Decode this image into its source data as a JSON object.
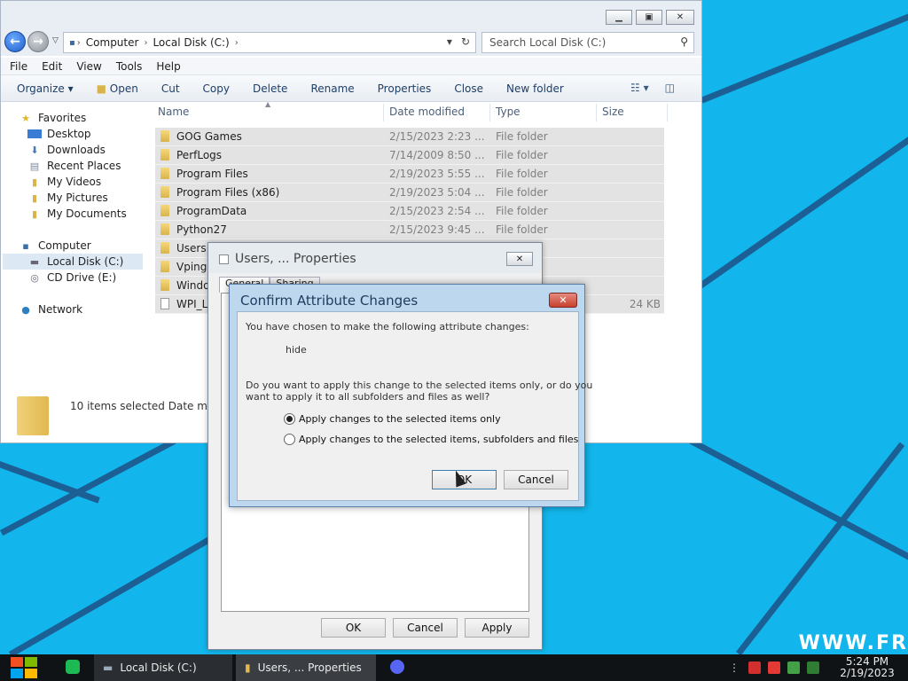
{
  "explorer": {
    "address": {
      "crumbs": [
        "Computer",
        "Local Disk (C:)"
      ]
    },
    "search_placeholder": "Search Local Disk (C:)",
    "menu": [
      "File",
      "Edit",
      "View",
      "Tools",
      "Help"
    ],
    "toolbar": [
      "Organize ▾",
      "Open",
      "Cut",
      "Copy",
      "Delete",
      "Rename",
      "Properties",
      "Close",
      "New folder"
    ],
    "nav": {
      "favorites": "Favorites",
      "favorites_items": [
        "Desktop",
        "Downloads",
        "Recent Places",
        "My Videos",
        "My Pictures",
        "My Documents"
      ],
      "computer": "Computer",
      "computer_items": [
        "Local Disk (C:)",
        "CD Drive (E:)"
      ],
      "network": "Network"
    },
    "columns": {
      "name": "Name",
      "date": "Date modified",
      "type": "Type",
      "size": "Size"
    },
    "files": [
      {
        "name": "GOG Games",
        "date": "2/15/2023 2:23 ...",
        "type": "File folder",
        "size": ""
      },
      {
        "name": "PerfLogs",
        "date": "7/14/2009 8:50 ...",
        "type": "File folder",
        "size": ""
      },
      {
        "name": "Program Files",
        "date": "2/19/2023 5:55 ...",
        "type": "File folder",
        "size": ""
      },
      {
        "name": "Program Files (x86)",
        "date": "2/19/2023 5:04 ...",
        "type": "File folder",
        "size": ""
      },
      {
        "name": "ProgramData",
        "date": "2/15/2023 2:54 ...",
        "type": "File folder",
        "size": ""
      },
      {
        "name": "Python27",
        "date": "2/15/2023 9:45 ...",
        "type": "File folder",
        "size": ""
      },
      {
        "name": "Users",
        "date": "",
        "type": "",
        "size": ""
      },
      {
        "name": "Vpings",
        "date": "",
        "type": "",
        "size": ""
      },
      {
        "name": "Window",
        "date": "",
        "type": "",
        "size": ""
      },
      {
        "name": "WPI_L",
        "date": "",
        "type": "",
        "size": "24 KB"
      }
    ],
    "details": "10 items selected  Date mo"
  },
  "properties": {
    "title": "Users, ... Properties",
    "tabs": [
      "General",
      "Sharing"
    ],
    "ok": "OK",
    "cancel": "Cancel",
    "apply": "Apply"
  },
  "confirm": {
    "title": "Confirm Attribute Changes",
    "intro": "You have chosen to make the following attribute changes:",
    "change": "hide",
    "question1": "Do you want to apply this change to the selected items only, or do you",
    "question2": "want to apply it to all subfolders and files as well?",
    "option1": "Apply changes to the selected items only",
    "option2": "Apply changes to the selected items, subfolders and files",
    "ok": "OK",
    "cancel": "Cancel"
  },
  "taskbar": {
    "items": [
      "Local Disk (C:)",
      "Users, ... Properties"
    ],
    "time": "5:24 PM",
    "date": "2/19/2023"
  },
  "watermark": "WWW.FR",
  "colors": {
    "desktop": "#12b6ec",
    "stripe": "#1b5f94",
    "selection": "#e3e3e3",
    "close_red": "#c7402d"
  }
}
